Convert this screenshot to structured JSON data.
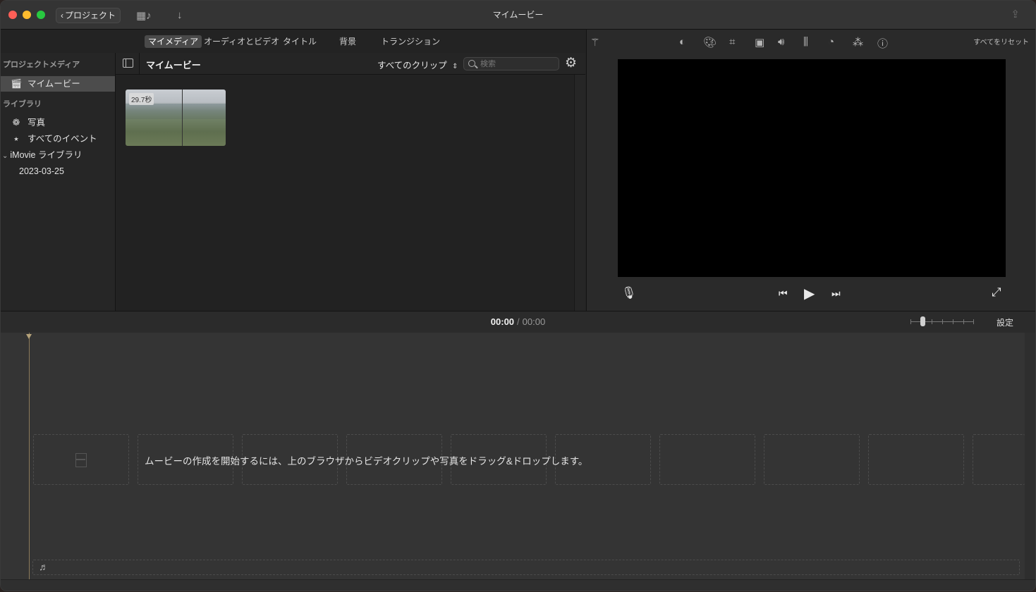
{
  "window": {
    "title": "マイムービー",
    "back_label": "プロジェクト"
  },
  "browser_tabs": [
    "マイメディア",
    "オーディオとビデオ",
    "タイトル",
    "背景",
    "トランジション"
  ],
  "sidebar": {
    "project_media_header": "プロジェクトメディア",
    "project_item": "マイムービー",
    "library_header": "ライブラリ",
    "library_items": [
      "写真",
      "すべてのイベント"
    ],
    "imovie_library": "iMovie ライブラリ",
    "event_date": "2023-03-25"
  },
  "browser": {
    "title": "マイムービー",
    "filter": "すべてのクリップ",
    "search_placeholder": "検索",
    "clips": [
      {
        "duration": "29.7秒"
      }
    ]
  },
  "viewer": {
    "reset_all": "すべてをリセット",
    "adjust_icons": [
      "color-balance-icon",
      "color-correction-icon",
      "crop-icon",
      "stabilization-icon",
      "volume-icon",
      "equalizer-icon",
      "speed-icon",
      "filter-icon",
      "info-icon"
    ]
  },
  "timeline": {
    "current_time": "00:00",
    "total_time": "00:00",
    "settings_label": "設定",
    "empty_message": "ムービーの作成を開始するには、上のブラウザからビデオクリップや写真をドラッグ&ドロップします。"
  },
  "colors": {
    "close": "#ff5f57",
    "minimize": "#febc2e",
    "zoom": "#28c840",
    "selection": "#4c4c4c"
  }
}
